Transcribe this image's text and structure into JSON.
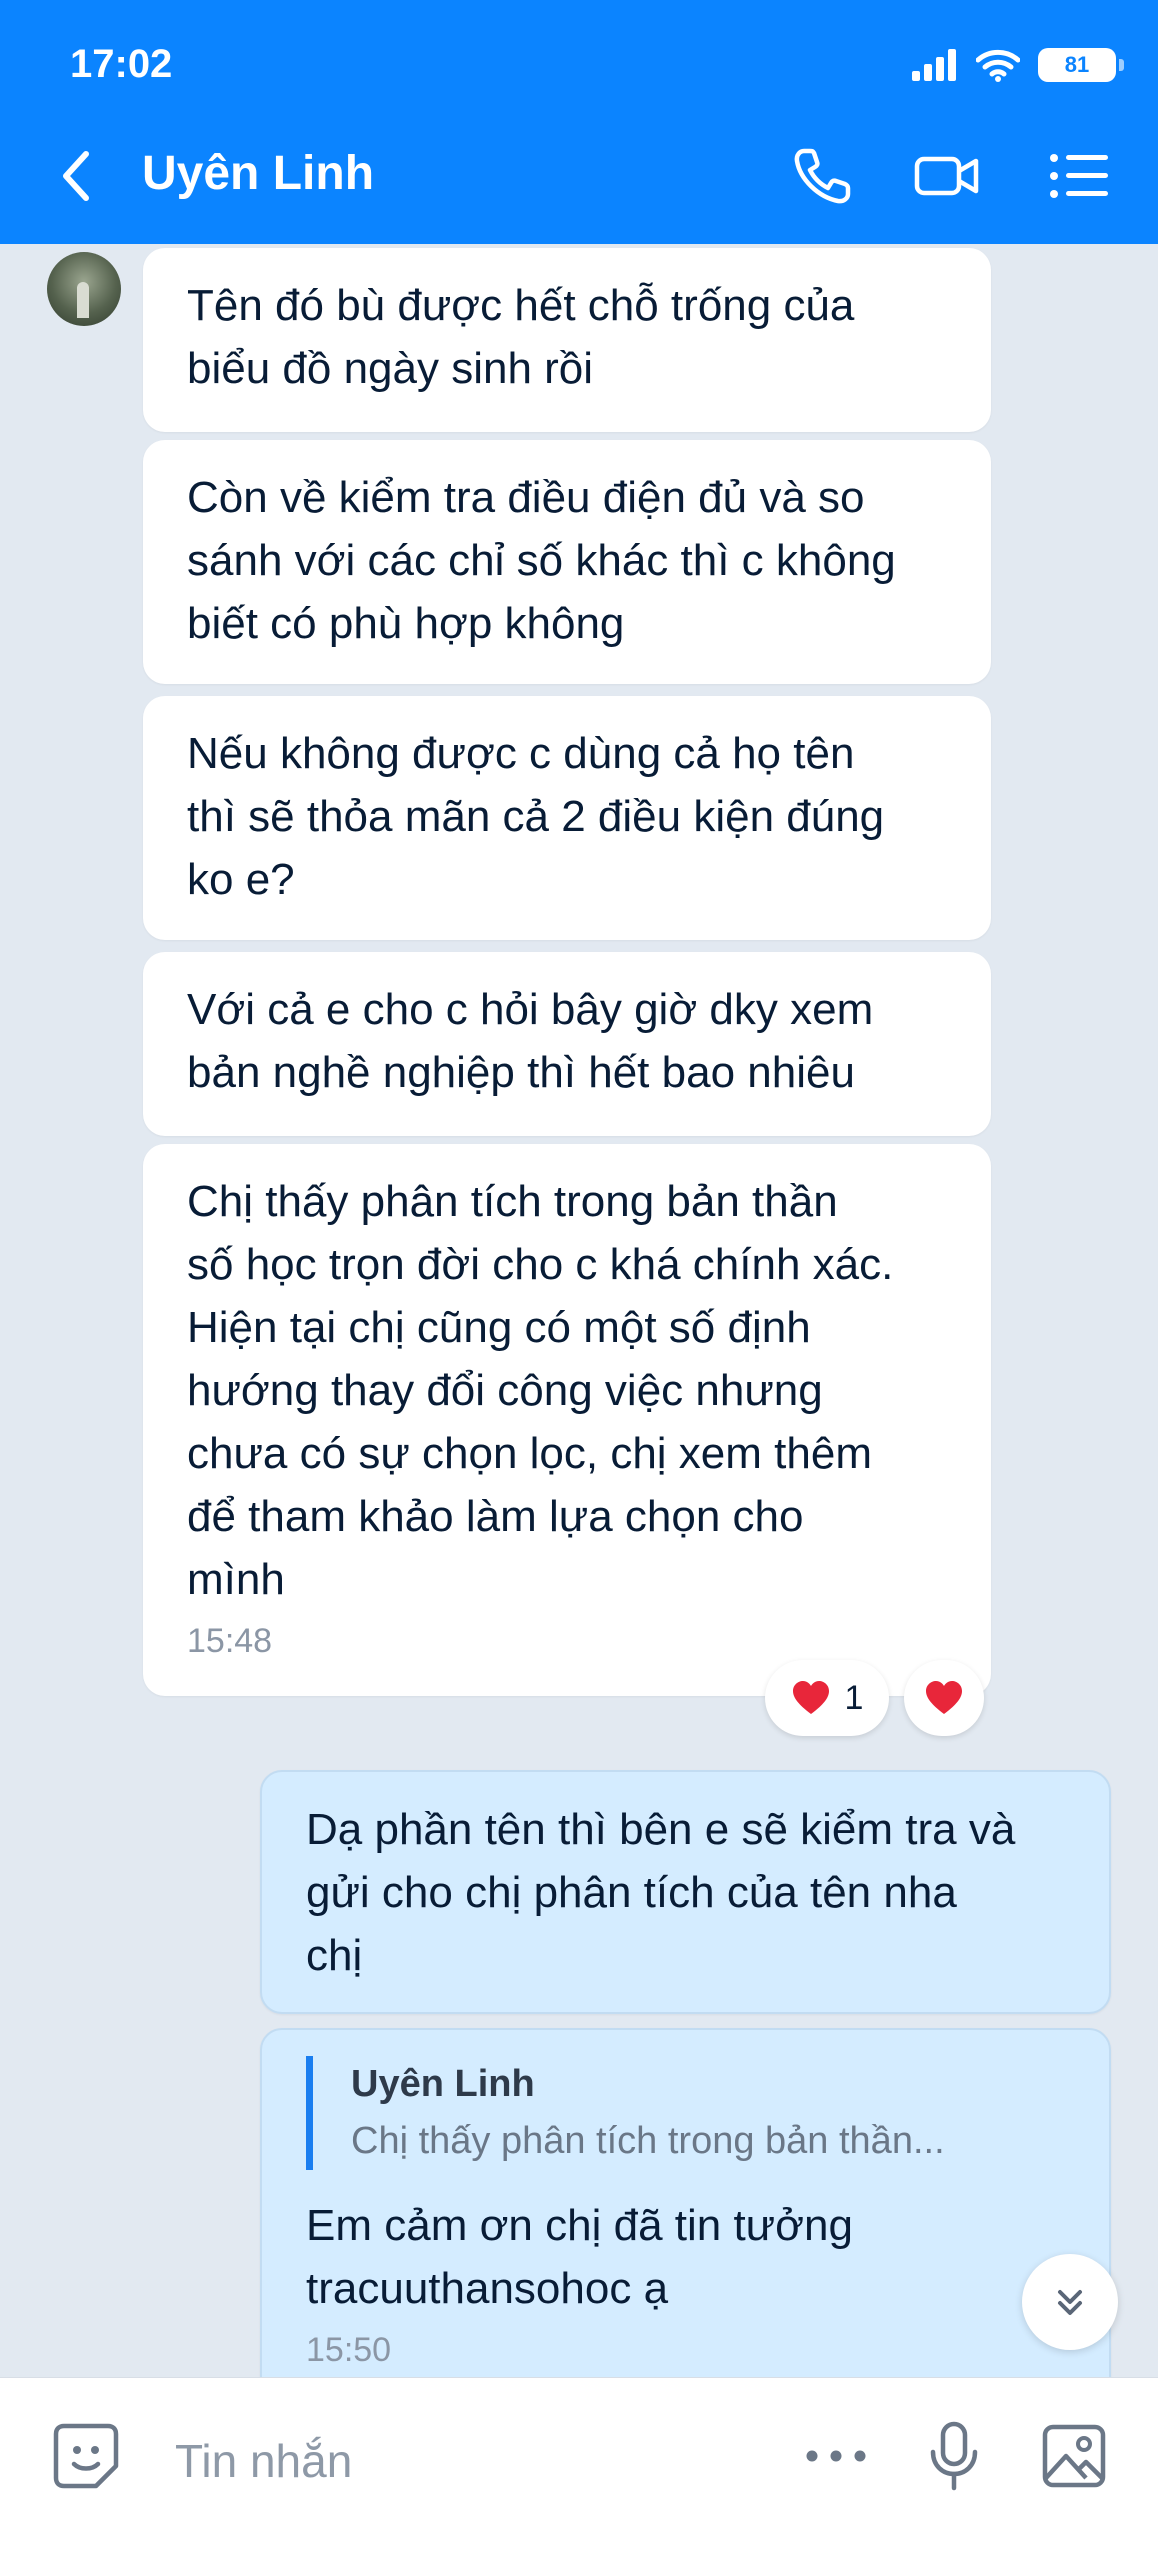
{
  "status": {
    "time": "17:02",
    "battery": "81"
  },
  "header": {
    "contact_name": "Uyên Linh"
  },
  "messages": [
    {
      "text": "Tên đó bù được hết chỗ trống của\nbiểu đồ ngày sinh rồi"
    },
    {
      "text": "Còn về kiểm tra điều điện đủ và so\nsánh với các chỉ số khác thì c không\nbiết có phù hợp không"
    },
    {
      "text": "Nếu không được c dùng cả họ tên\nthì sẽ thỏa mãn cả 2 điều kiện đúng\nko e?"
    },
    {
      "text": "Với cả e cho c hỏi bây giờ dky xem\nbản nghề nghiệp thì hết bao nhiêu"
    },
    {
      "text": "Chị thấy phân tích trong bản thần\nsố học trọn đời cho c khá chính xác.\nHiện tại chị cũng có một số định\nhướng thay đổi công việc nhưng\nchưa có sự chọn lọc, chị xem thêm\nđể tham khảo làm lựa chọn cho\nmình",
      "time": "15:48"
    },
    {
      "text": "Dạ phần tên thì bên e sẽ kiểm tra và\ngửi cho chị phân tích của tên nha\nchị"
    },
    {
      "quote_name": "Uyên Linh",
      "quote_text": "Chị thấy phân tích trong bản thần...",
      "text": "Em cảm ơn chị đã tin tưởng\ntracuuthansohoc ạ",
      "time": "15:50"
    }
  ],
  "reaction": {
    "count": "1"
  },
  "input": {
    "placeholder": "Tin nhắn"
  },
  "colors": {
    "header": "#0b84ff",
    "background": "#e2e9f1",
    "outgoing": "#d4ecff",
    "heart": "#e8263a"
  },
  "icons": [
    "back-icon",
    "phone-icon",
    "video-call-icon",
    "menu-list-icon",
    "sticker-icon",
    "more-icon",
    "microphone-icon",
    "image-icon",
    "scroll-down-icon",
    "heart-icon"
  ]
}
